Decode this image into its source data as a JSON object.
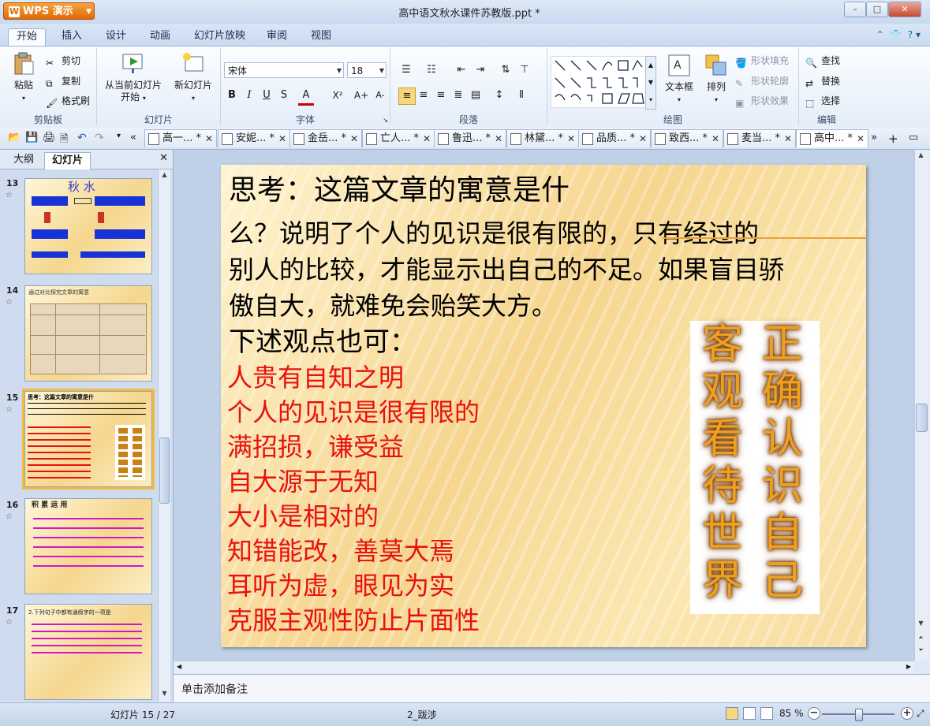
{
  "app": {
    "menu_label": "WPS 演示",
    "doc_title": "高中语文秋水课件苏教版.ppt *"
  },
  "window": {
    "minimize": "–",
    "restore": "□",
    "close": "✕"
  },
  "tabs": [
    {
      "label": "开始"
    },
    {
      "label": "插入"
    },
    {
      "label": "设计"
    },
    {
      "label": "动画"
    },
    {
      "label": "幻灯片放映"
    },
    {
      "label": "审阅"
    },
    {
      "label": "视图"
    }
  ],
  "ribbon": {
    "clipboard": {
      "paste": "粘贴",
      "cut": "剪切",
      "copy": "复制",
      "format_painter": "格式刷",
      "label": "剪贴板"
    },
    "slides": {
      "from_current": "从当前幻灯片",
      "from_current_2": "开始",
      "new_slide": "新幻灯片",
      "label": "幻灯片"
    },
    "font": {
      "name": "宋体",
      "size": "18",
      "label": "字体",
      "bold": "B",
      "italic": "I",
      "underline": "U",
      "strike": "S",
      "color": "A",
      "sup": "X²",
      "grow": "A+",
      "shrink": "A-"
    },
    "paragraph": {
      "label": "段落"
    },
    "drawing": {
      "textbox": "文本框",
      "arrange": "排列",
      "shape_fill": "形状填充",
      "shape_outline": "形状轮廓",
      "shape_effect": "形状效果",
      "label": "绘图"
    },
    "editing": {
      "find": "查找",
      "replace": "替换",
      "select": "选择",
      "label": "编辑"
    }
  },
  "doc_tabs": [
    {
      "label": "高一... *"
    },
    {
      "label": "安妮... *"
    },
    {
      "label": "金岳... *"
    },
    {
      "label": "亡人... *"
    },
    {
      "label": "鲁迅... *"
    },
    {
      "label": "林黛... *"
    },
    {
      "label": "品质... *"
    },
    {
      "label": "致西... *"
    },
    {
      "label": "麦当... *"
    },
    {
      "label": "高中... *"
    }
  ],
  "left_pane": {
    "tab_outline": "大纲",
    "tab_slides": "幻灯片",
    "close": "✕",
    "slides": [
      {
        "num": "13",
        "title": "秋  水"
      },
      {
        "num": "14",
        "title": "通过对比探究文章的寓意"
      },
      {
        "num": "15",
        "title": "思考：这篇文章的寓意是什"
      },
      {
        "num": "16",
        "title": "积  累  运  用"
      },
      {
        "num": "17",
        "title": "2.下列句子中都有通假字的一项是"
      }
    ]
  },
  "slide": {
    "line1": "思考：这篇文章的寓意是什",
    "line2": "么？说明了个人的见识是很有限的，只有经过的",
    "line3": "别人的比较，才能显示出自己的不足。如果盲目骄",
    "line4": "傲自大，就难免会贻笑大方。",
    "line5": "下述观点也可：",
    "red": [
      "人贵有自知之明",
      "个人的见识是很有限的",
      "满招损，谦受益",
      "自大源于无知",
      "大小是相对的",
      "知错能改，善莫大焉",
      "耳听为虚，眼见为实",
      "克服主观性防止片面性"
    ],
    "vert_right": [
      "正",
      "确",
      "认",
      "识",
      "自",
      "己"
    ],
    "vert_left": [
      "客",
      "观",
      "看",
      "待",
      "世",
      "界"
    ]
  },
  "notes_placeholder": "单击添加备注",
  "status": {
    "slide_count": "幻灯片 15 / 27",
    "theme": "2_跋涉",
    "zoom": "85 %",
    "zoom_level": 0.5
  }
}
